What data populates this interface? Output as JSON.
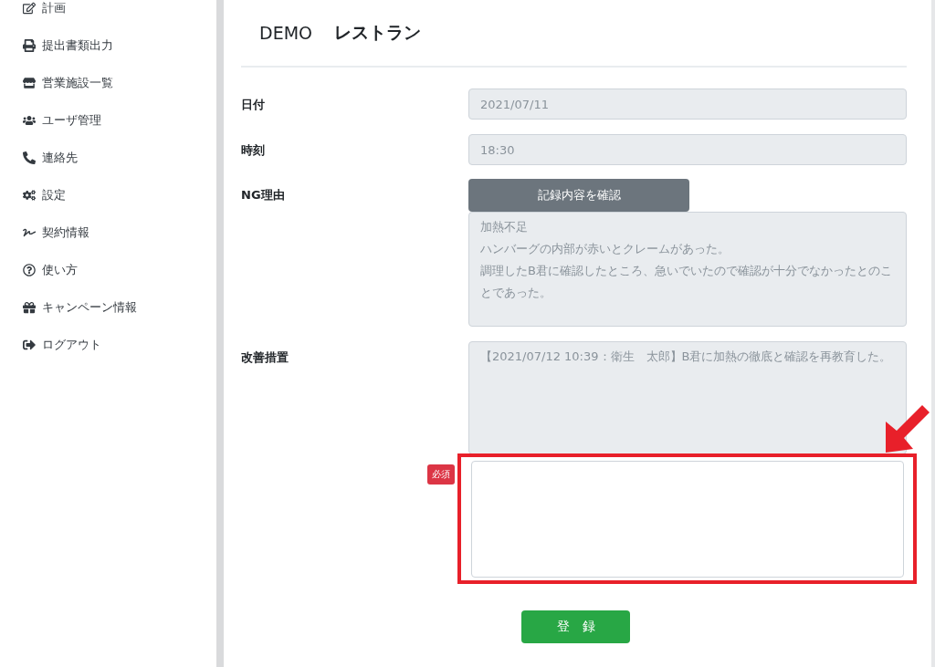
{
  "sidebar": {
    "items": [
      {
        "label": "計画"
      },
      {
        "label": "提出書類出力"
      },
      {
        "label": "営業施設一覧"
      },
      {
        "label": "ユーザ管理"
      },
      {
        "label": "連絡先"
      },
      {
        "label": "設定"
      },
      {
        "label": "契約情報"
      },
      {
        "label": "使い方"
      },
      {
        "label": "キャンペーン情報"
      },
      {
        "label": "ログアウト"
      }
    ]
  },
  "header": {
    "code": "DEMO",
    "name": "レストラン"
  },
  "form": {
    "date": {
      "label": "日付",
      "value": "2021/07/11"
    },
    "time": {
      "label": "時刻",
      "value": "18:30"
    },
    "ng_reason": {
      "label": "NG理由",
      "button": "記録内容を確認",
      "lines": [
        "加熱不足",
        "ハンバーグの内部が赤いとクレームがあった。",
        "調理したB君に確認したところ、急いでいたので確認が十分でなかったとのことであった。"
      ]
    },
    "improvement": {
      "label": "改善措置",
      "history": "【2021/07/12 10:39：衛生　太郎】B君に加熱の徹底と確認を再教育した。",
      "required_badge": "必須",
      "highlighted": true
    },
    "submit": "登　録"
  }
}
